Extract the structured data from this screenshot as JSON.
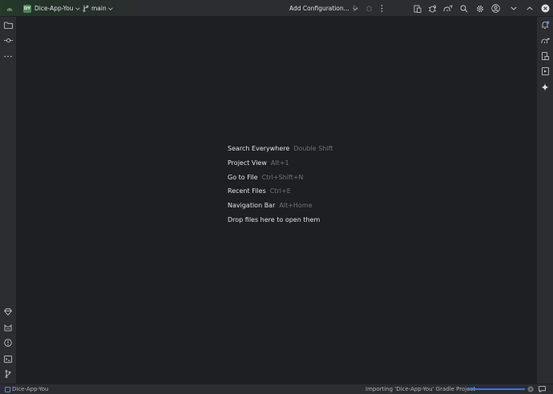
{
  "titlebar": {
    "project_badge": "DY",
    "project_name": "Dice-App-You",
    "branch": "main",
    "run_config": "Add Configuration..."
  },
  "hints": [
    {
      "label": "Search Everywhere",
      "key": "Double Shift"
    },
    {
      "label": "Project View",
      "key": "Alt+1"
    },
    {
      "label": "Go to File",
      "key": "Ctrl+Shift+N"
    },
    {
      "label": "Recent Files",
      "key": "Ctrl+E"
    },
    {
      "label": "Navigation Bar",
      "key": "Alt+Home"
    },
    {
      "label": "Drop files here to open them",
      "key": ""
    }
  ],
  "statusbar": {
    "project": "Dice-App-You",
    "task": "Importing 'Dice-App-You' Gradle Project",
    "progress": 0.98
  },
  "colors": {
    "background": "#1e1f22",
    "panel": "#2b2d30",
    "accent": "#3574f0",
    "badge": "#4a8a5c",
    "notification": "#548af7"
  }
}
